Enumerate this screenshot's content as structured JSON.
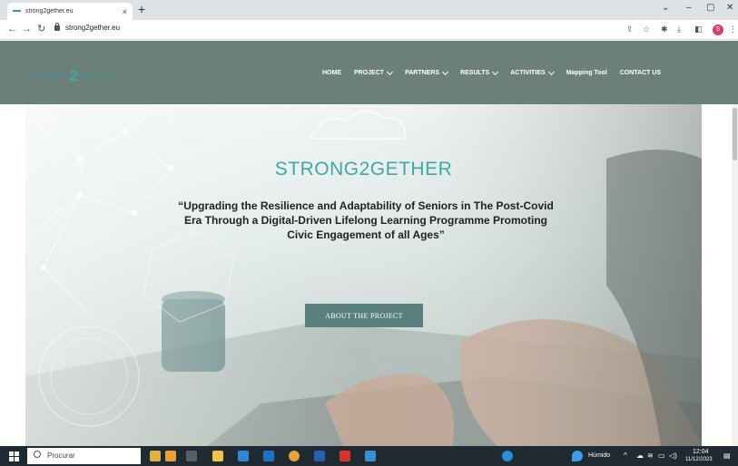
{
  "browser": {
    "tab_title": "strong2gether.eu",
    "tab_close": "×",
    "new_tab": "+",
    "url": "strong2gether.eu",
    "controls": {
      "minimize": "–",
      "maximize": "▢",
      "close": "✕",
      "tab_search": "⌄"
    },
    "profile_initial": "S"
  },
  "site": {
    "logo_left": "STRONG",
    "logo_two": "2",
    "logo_right": "GETHER",
    "menu": [
      {
        "label": "HOME",
        "has_caret": false
      },
      {
        "label": "PROJECT",
        "has_caret": true
      },
      {
        "label": "PARTNERS",
        "has_caret": true
      },
      {
        "label": "RESULTS",
        "has_caret": true
      },
      {
        "label": "ACTIVITIES",
        "has_caret": true
      },
      {
        "label": "Mapping Tool",
        "has_caret": false
      },
      {
        "label": "CONTACT US",
        "has_caret": false
      }
    ],
    "hero": {
      "title": "STRONG2GETHER",
      "subtitle": "“Upgrading the Resilience and Adaptability of Seniors in The Post-Covid Era Through a Digital-Driven Lifelong Learning Programme Promoting Civic Engagement of all Ages”",
      "button": "ABOUT THE PROJECT"
    }
  },
  "taskbar": {
    "search_placeholder": "Procurar",
    "weather": "Húmido",
    "time": "12:04",
    "date": "11/12/2023"
  },
  "colors": {
    "header": "#6b8079",
    "accent": "#3ea8a8",
    "button": "#59807e",
    "taskbar": "#1f2a33"
  }
}
